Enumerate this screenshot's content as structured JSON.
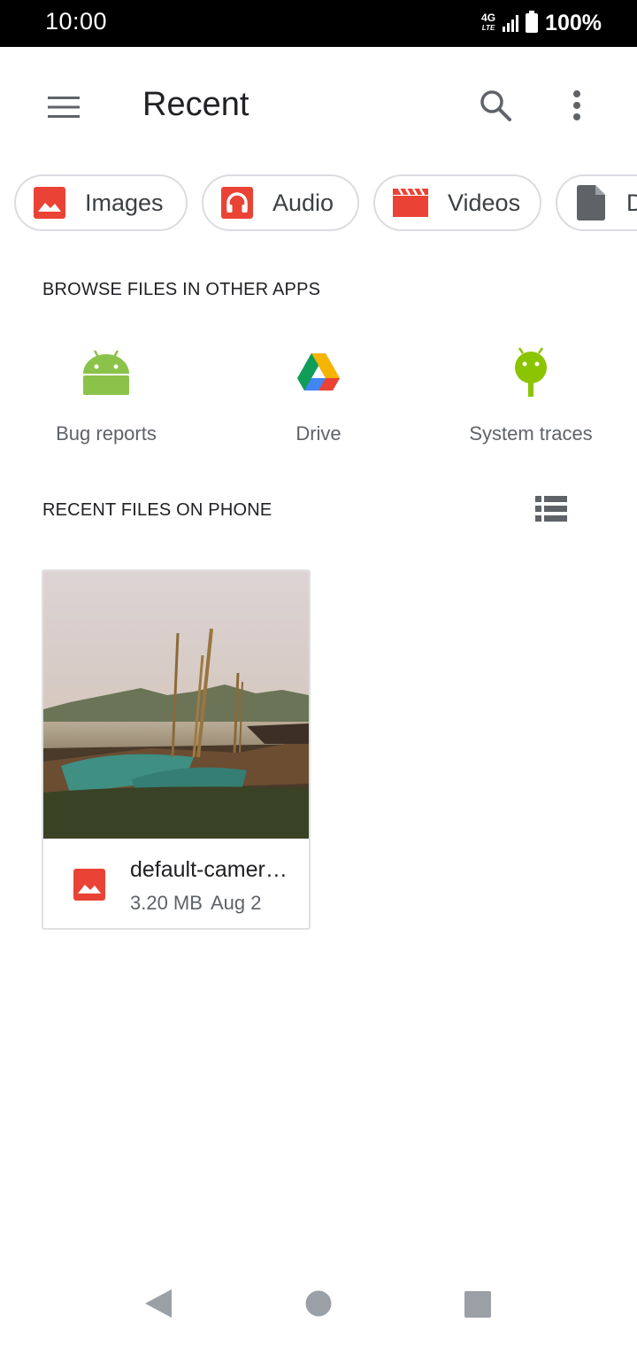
{
  "status_bar": {
    "time": "10:00",
    "network": "4G",
    "network_sub": "LTE",
    "battery": "100%"
  },
  "app_bar": {
    "title": "Recent",
    "menu_icon": "hamburger-menu-icon",
    "search_icon": "search-icon",
    "more_icon": "more-vert-icon"
  },
  "chips": [
    {
      "label": "Images",
      "icon": "image-icon",
      "color": "#ea4335"
    },
    {
      "label": "Audio",
      "icon": "headphones-icon",
      "color": "#ea4335"
    },
    {
      "label": "Videos",
      "icon": "movie-clapper-icon",
      "color": "#ea4335"
    },
    {
      "label": "Documents",
      "icon": "document-icon",
      "color": "#5f6368"
    }
  ],
  "browse_section": {
    "header": "BROWSE FILES IN OTHER APPS",
    "apps": [
      {
        "label": "Bug reports",
        "icon": "android-icon",
        "color": "#8bc34a"
      },
      {
        "label": "Drive",
        "icon": "google-drive-icon"
      },
      {
        "label": "System traces",
        "icon": "android-trace-icon",
        "color": "#8bc400"
      }
    ]
  },
  "recent_section": {
    "header": "RECENT FILES ON PHONE",
    "view_toggle_icon": "list-view-icon",
    "files": [
      {
        "name": "default-camera-photo.jpg",
        "size": "3.20 MB",
        "date": "Aug 2",
        "icon": "image-icon"
      }
    ]
  },
  "nav_bar": {
    "back_icon": "back-triangle-icon",
    "home_icon": "home-circle-icon",
    "recents_icon": "recents-square-icon"
  },
  "colors": {
    "accent_red": "#ea4335",
    "text_primary": "#202124",
    "text_secondary": "#5f6368",
    "chip_border": "#dadce0"
  }
}
